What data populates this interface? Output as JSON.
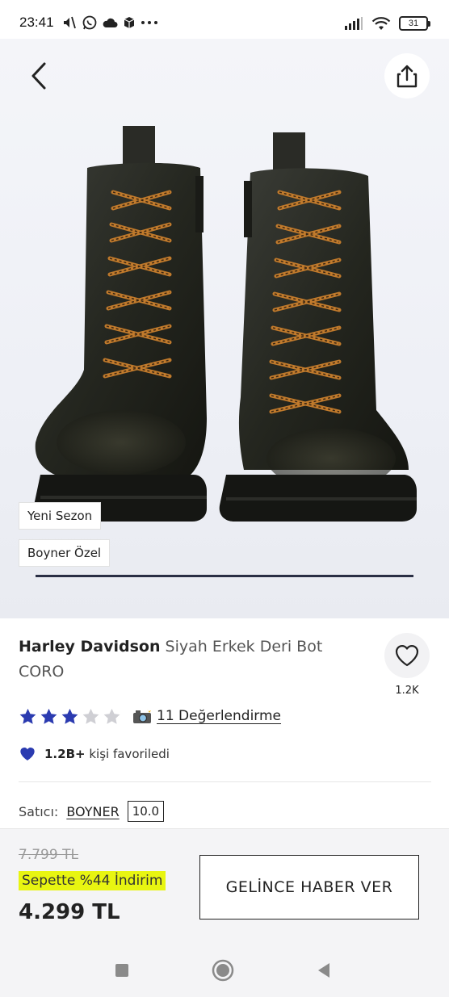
{
  "status_bar": {
    "time": "23:41",
    "battery": "31",
    "icons_left": [
      "mute-icon",
      "whatsapp-icon",
      "cloud-icon",
      "box-icon",
      "more-dots-icon"
    ],
    "icons_right": [
      "signal-icon",
      "wifi-icon",
      "battery-icon"
    ]
  },
  "hero": {
    "badges": [
      "Yeni Sezon",
      "Boyner Özel"
    ]
  },
  "product": {
    "brand": "Harley Davidson",
    "name": "Siyah Erkek Deri Bot CORO",
    "favorite_count": "1.2K",
    "rating": 3,
    "rating_max": 5,
    "reviews_label": "11 Değerlendirme",
    "favorited_count": "1.2B+",
    "favorited_label": "kişi favoriledi",
    "seller_label": "Satıcı:",
    "seller_name": "BOYNER",
    "seller_score": "10.0"
  },
  "purchase": {
    "old_price": "7.799 TL",
    "discount_label": "Sepette %44 İndirim",
    "price": "4.299 TL",
    "notify_button": "GELİNCE HABER VER"
  },
  "colors": {
    "star_filled": "#2b3bb0",
    "star_empty": "#cfcfd4",
    "heart_blue": "#2b3bb0",
    "discount_highlight": "#e8f511"
  }
}
